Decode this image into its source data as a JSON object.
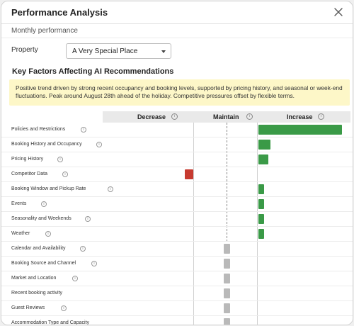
{
  "dialog": {
    "title": "Performance Analysis",
    "close_icon": "close-icon",
    "subtitle": "Monthly performance"
  },
  "property": {
    "label": "Property",
    "selected": "A Very Special Place"
  },
  "factors": {
    "section_title": "Key Factors Affecting AI Recommendations",
    "summary": "Positive trend driven by strong recent occupancy and booking levels, supported by pricing history, and seasonal or week-end fluctuations. Peak around August 28th ahead of the holiday. Competitive pressures offset by flexible terms.",
    "columns": {
      "decrease": "Decrease",
      "maintain": "Maintain",
      "increase": "Increase"
    },
    "colors": {
      "increase": "#3a9a47",
      "decrease": "#c73a30",
      "maintain": "#b9b9b9",
      "summary_bg": "#fdf7c8"
    },
    "rows": [
      {
        "label": "Policies and Restrictions",
        "direction": "increase",
        "strength": 1.0
      },
      {
        "label": "Booking History and Occupancy",
        "direction": "increase",
        "strength": 0.14
      },
      {
        "label": "Pricing History",
        "direction": "increase",
        "strength": 0.12
      },
      {
        "label": "Competitor Data",
        "direction": "decrease",
        "strength": 0.11
      },
      {
        "label": "Booking Window and Pickup Rate",
        "direction": "increase",
        "strength": 0.07
      },
      {
        "label": "Events",
        "direction": "increase",
        "strength": 0.07
      },
      {
        "label": "Seasonality and Weekends",
        "direction": "increase",
        "strength": 0.07
      },
      {
        "label": "Weather",
        "direction": "increase",
        "strength": 0.07
      },
      {
        "label": "Calendar and Availability",
        "direction": "maintain",
        "strength": 1.0
      },
      {
        "label": "Booking Source and Channel",
        "direction": "maintain",
        "strength": 1.0
      },
      {
        "label": "Market and Location",
        "direction": "maintain",
        "strength": 1.0
      },
      {
        "label": "Recent booking activity",
        "direction": "maintain",
        "strength": 1.0
      },
      {
        "label": "Guest Reviews",
        "direction": "maintain",
        "strength": 1.0
      },
      {
        "label": "Accommodation Type and Capacity",
        "direction": "maintain",
        "strength": 1.0
      }
    ]
  }
}
